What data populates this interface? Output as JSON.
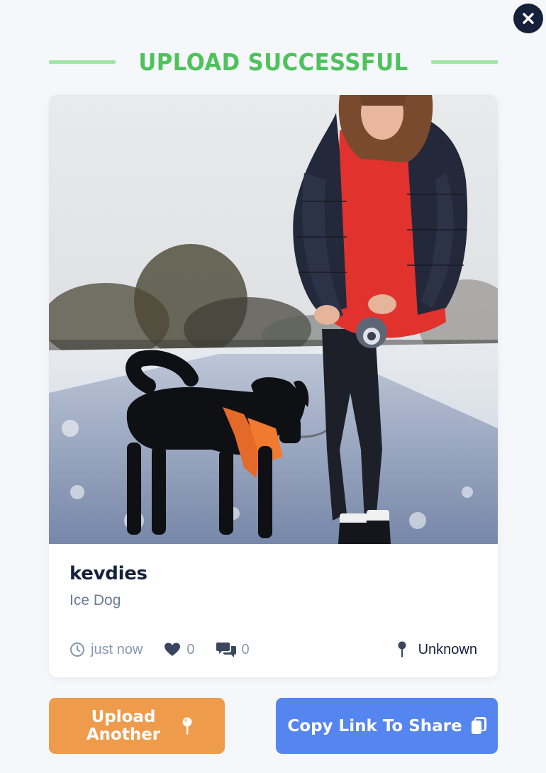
{
  "header": {
    "title": "UPLOAD SUCCESSFUL"
  },
  "post": {
    "username": "kevdies",
    "caption": "Ice Dog",
    "time": "just now",
    "likes": "0",
    "comments": "0",
    "location": "Unknown"
  },
  "buttons": {
    "upload_another_line1": "Upload",
    "upload_another_line2": "Another",
    "copy_link": "Copy Link To Share"
  },
  "icons": {
    "close": "close-icon",
    "clock": "clock-icon",
    "heart": "heart-icon",
    "comments": "comments-icon",
    "pin": "pin-icon",
    "copy": "copy-icon"
  },
  "colors": {
    "title_green": "#4ec25b",
    "divider_green": "#9ee6a7",
    "navy": "#15203a",
    "upload_orange": "#ee9b4b",
    "copy_blue": "#5585ee"
  }
}
